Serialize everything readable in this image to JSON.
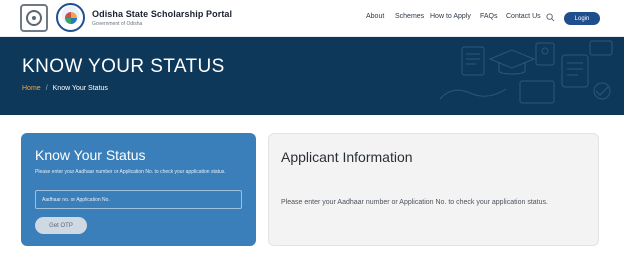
{
  "header": {
    "brand_title": "Odisha State Scholarship Portal",
    "brand_subtitle": "Government of Odisha",
    "nav": {
      "about": "About",
      "schemes": "Schemes",
      "how_to_apply": "How to Apply",
      "faqs": "FAQs",
      "contact_us": "Contact Us"
    },
    "login_label": "Login",
    "icons": {
      "search": "search-icon"
    }
  },
  "banner": {
    "title": "KNOW YOUR STATUS",
    "breadcrumb": {
      "home": "Home",
      "separator": "/",
      "current": "Know Your Status"
    }
  },
  "status_card": {
    "title": "Know Your Status",
    "description": "Please enter your Aadhaar number or Application No. to check your application status.",
    "input_placeholder": "Aadhaar no. or Application No.",
    "button_label": "Get OTP"
  },
  "info_card": {
    "title": "Applicant Information",
    "text": "Please enter your Aadhaar number or Application No. to check your application status."
  },
  "colors": {
    "banner_bg": "#0e3859",
    "card_blue": "#3a7fb9",
    "login_blue": "#1e4e8c",
    "breadcrumb_home": "#f5a53a"
  }
}
